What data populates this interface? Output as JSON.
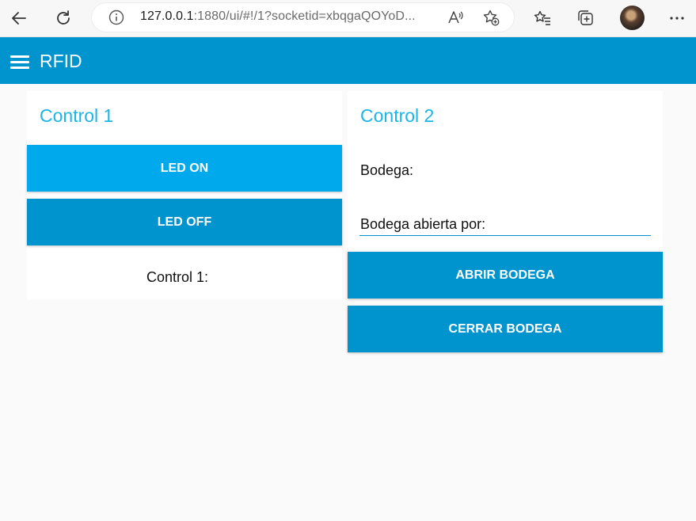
{
  "browser": {
    "url_host": "127.0.0.1",
    "url_rest": ":1880/ui/#!/1?socketid=xbqgaQOYoD..."
  },
  "header": {
    "title": "RFID"
  },
  "control1": {
    "title": "Control 1",
    "led_on_label": "LED ON",
    "led_off_label": "LED OFF",
    "status_label": "Control 1:"
  },
  "control2": {
    "title": "Control 2",
    "bodega_label": "Bodega:",
    "opened_by_label": "Bodega abierta por:",
    "open_button_label": "ABRIR BODEGA",
    "close_button_label": "CERRAR BODEGA"
  },
  "colors": {
    "header": "#0094ce",
    "title_accent": "#1bb5e8",
    "button_primary": "#0094ce",
    "button_highlight": "#00a8ec"
  }
}
